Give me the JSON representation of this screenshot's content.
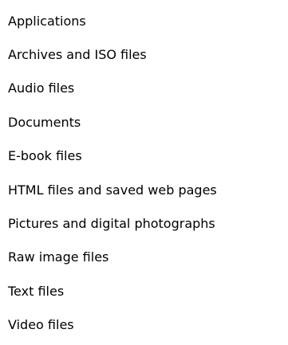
{
  "menu": {
    "items": [
      {
        "label": "Applications"
      },
      {
        "label": "Archives and ISO files"
      },
      {
        "label": "Audio files"
      },
      {
        "label": "Documents"
      },
      {
        "label": "E-book files"
      },
      {
        "label": "HTML files and saved web pages"
      },
      {
        "label": "Pictures and digital photographs"
      },
      {
        "label": "Raw image files"
      },
      {
        "label": "Text files"
      },
      {
        "label": "Video files"
      }
    ]
  }
}
